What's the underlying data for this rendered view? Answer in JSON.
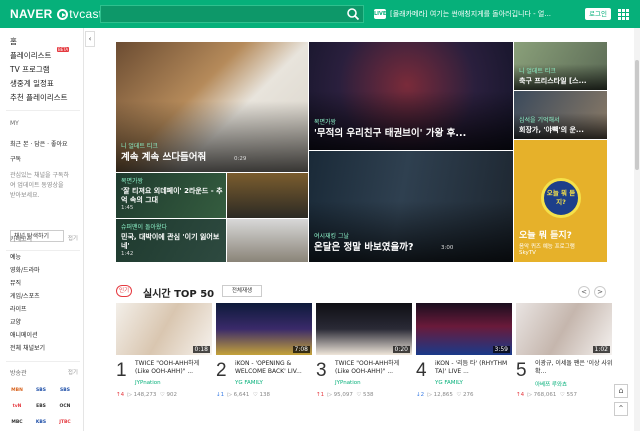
{
  "header": {
    "logo_naver": "NAVER",
    "logo_tvcast": "tvcast",
    "search_placeholder": "",
    "live_badge": "LIVE",
    "ticker": "[몰래카메라] 여기는 썬애칭지게를 돌아러깁니다 - 얼...",
    "login_label": "로그인",
    "accent_color": "#06b07a"
  },
  "sidebar": {
    "nav": [
      {
        "label": "홈"
      },
      {
        "label": "플레이리스트",
        "badge": "BETA"
      },
      {
        "label": "TV 프로그램"
      },
      {
        "label": "생중계 일정표"
      },
      {
        "label": "추천 플레이리스트"
      }
    ],
    "my_section": "MY",
    "my_items": [
      "최근 본 · 담은 · 좋아요",
      "구독"
    ],
    "my_desc": [
      "관심있는 채널을 구독하",
      "여 업데이트 동영상을",
      "받아보세요."
    ],
    "channel_button": "채널 탐색하기",
    "category_section": "카테고리",
    "category_more": "접기",
    "categories": [
      "예능",
      "영화/드라마",
      "뮤직",
      "게임/스포츠",
      "라이프",
      "교양",
      "애니메이션",
      "전체 채널보기"
    ],
    "broadcast_section": "방송관",
    "broadcast_more": "접기",
    "broadcasters": [
      "MBN",
      "SBS",
      "SBS",
      "tvN",
      "EBS",
      "OCN",
      "MBC",
      "KBS",
      "JTBC"
    ]
  },
  "featured": [
    {
      "tag": "니 얼데트 티크",
      "title": "계속 계속 쓰다듬어줘",
      "time": "0:29"
    },
    {
      "tag": "복면가왕",
      "title": "'무적의 우리친구 태권브이' 가왕 후..."
    },
    {
      "tag": "니 얼데트 티크",
      "title": "축구 프리스타일 [스...",
      "time": ""
    },
    {
      "tag": "복면가왕",
      "title": "'잘 티져요 외데페이' 2라운드 - 추억 속의 그대",
      "time": "1:45"
    },
    {
      "tag": "심석을 기억해서",
      "title": "회장가, '야빽'의 운...",
      "time": ""
    },
    {
      "tag": "슈퍼맨이 돌아왔다",
      "title": "민국, 대박이에 관심 '이기 잃어보네'",
      "time": "1:42"
    },
    {
      "tag": "여시재킹 그날",
      "title": "온달은 정말 바보였을까?",
      "time": "3:00"
    },
    {
      "tag": "음악 퀴즈 예능 프로그램",
      "title": "오늘 뭐 듣지?",
      "channel": "SkyTV",
      "logo": "오늘 뭐 듣지?"
    }
  ],
  "top50": {
    "hot": "인기",
    "title": "실시간 TOP 50",
    "all_label": "전체재생",
    "prev": "<",
    "next": ">"
  },
  "videos": [
    {
      "rank": "1",
      "title": "TWICE \"OOH-AHH하게 (Like OOH-AHH)\" ...",
      "channel": "JYPnation",
      "duration": "0:18",
      "change": "↑4",
      "views": "148,273",
      "likes": "902",
      "change_dir": "up"
    },
    {
      "rank": "2",
      "title": "iKON - 'OPENING & WELCOME BACK' LIV...",
      "channel": "YG FAMILY",
      "duration": "7:08",
      "change": "↓1",
      "views": "6,641",
      "likes": "138",
      "change_dir": "down"
    },
    {
      "rank": "3",
      "title": "TWICE \"OOH-AHH하게 (Like OOH-AHH)\" ...",
      "channel": "JYPnation",
      "duration": "0:20",
      "change": "↑1",
      "views": "95,097",
      "likes": "538",
      "change_dir": "up"
    },
    {
      "rank": "4",
      "title": "iKON - '리듬 타' (RHYTHM TA)' LIVE ...",
      "channel": "YG FAMILY",
      "duration": "3:59",
      "change": "↓2",
      "views": "12,865",
      "likes": "276",
      "change_dir": "down"
    },
    {
      "rank": "5",
      "title": "이광규, 이세돌 팬은 '이상 사위 확...",
      "channel": "아베쯔 루와쵸",
      "duration": "1:02",
      "change": "↑4",
      "views": "768,061",
      "likes": "557",
      "change_dir": "up"
    }
  ]
}
